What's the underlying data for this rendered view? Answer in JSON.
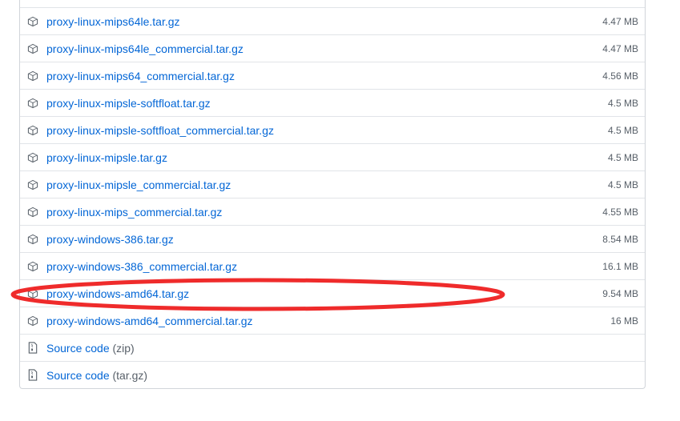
{
  "assets": [
    {
      "name": "",
      "size": ""
    },
    {
      "name": "proxy-linux-mips64le.tar.gz",
      "size": "4.47 MB"
    },
    {
      "name": "proxy-linux-mips64le_commercial.tar.gz",
      "size": "4.47 MB"
    },
    {
      "name": "proxy-linux-mips64_commercial.tar.gz",
      "size": "4.56 MB"
    },
    {
      "name": "proxy-linux-mipsle-softfloat.tar.gz",
      "size": "4.5 MB"
    },
    {
      "name": "proxy-linux-mipsle-softfloat_commercial.tar.gz",
      "size": "4.5 MB"
    },
    {
      "name": "proxy-linux-mipsle.tar.gz",
      "size": "4.5 MB"
    },
    {
      "name": "proxy-linux-mipsle_commercial.tar.gz",
      "size": "4.5 MB"
    },
    {
      "name": "proxy-linux-mips_commercial.tar.gz",
      "size": "4.55 MB"
    },
    {
      "name": "proxy-windows-386.tar.gz",
      "size": "8.54 MB"
    },
    {
      "name": "proxy-windows-386_commercial.tar.gz",
      "size": "16.1 MB"
    },
    {
      "name": "proxy-windows-amd64.tar.gz",
      "size": "9.54 MB"
    },
    {
      "name": "proxy-windows-amd64_commercial.tar.gz",
      "size": "16 MB"
    }
  ],
  "source": [
    {
      "label": "Source code",
      "ext": "(zip)"
    },
    {
      "label": "Source code",
      "ext": "(tar.gz)"
    }
  ],
  "annotation": {
    "color": "#ef2b2b"
  },
  "colors": {
    "link": "#0366d6",
    "muted": "#586069",
    "border": "#e1e4e8"
  }
}
